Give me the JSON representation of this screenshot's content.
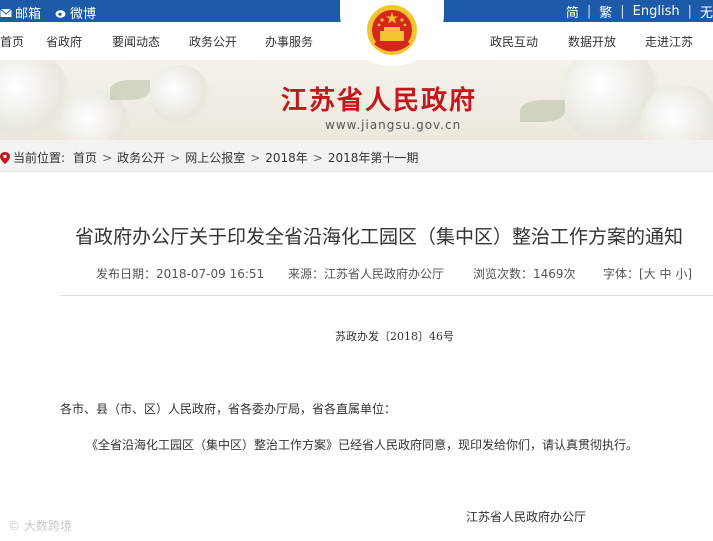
{
  "topbar": {
    "left_items": [
      {
        "label": "邮箱",
        "icon": "mail-icon"
      },
      {
        "label": "微博",
        "icon": "weibo-icon"
      }
    ],
    "lang": {
      "simplified": "简",
      "traditional": "繁",
      "english": "English",
      "accessible": "无"
    }
  },
  "nav": {
    "items": [
      "首页",
      "省政府",
      "要闻动态",
      "政务公开",
      "办事服务",
      "政民互动",
      "数据开放",
      "走进江苏"
    ]
  },
  "banner": {
    "title": "江苏省人民政府",
    "url": "www.jiangsu.gov.cn"
  },
  "breadcrumb": {
    "label": "当前位置:",
    "items": [
      "首页",
      "政务公开",
      "网上公报室",
      "2018年",
      "2018年第十一期"
    ],
    "separator": ">"
  },
  "article": {
    "title": "省政府办公厅关于印发全省沿海化工园区（集中区）整治工作方案的通知",
    "publish_label": "发布日期：",
    "publish_date": "2018-07-09 16:51",
    "source_label": "来源：",
    "source": "江苏省人民政府办公厅",
    "views_label": "浏览次数：",
    "views": "1469次",
    "font_label": "字体：",
    "font_options": "[大 中 小]",
    "doc_number": "苏政办发〔2018〕46号",
    "para1": "各市、县（市、区）人民政府，省各委办厅局，省各直属单位：",
    "para2": "《全省沿海化工园区（集中区）整治工作方案》已经省人民政府同意，现印发给你们，请认真贯彻执行。",
    "signature": "江苏省人民政府办公厅"
  },
  "watermark": "大数跨境",
  "colors": {
    "topbar": "#1d5aa8",
    "title_red": "#c4161c",
    "crumb_bg": "#f2f2f2"
  }
}
